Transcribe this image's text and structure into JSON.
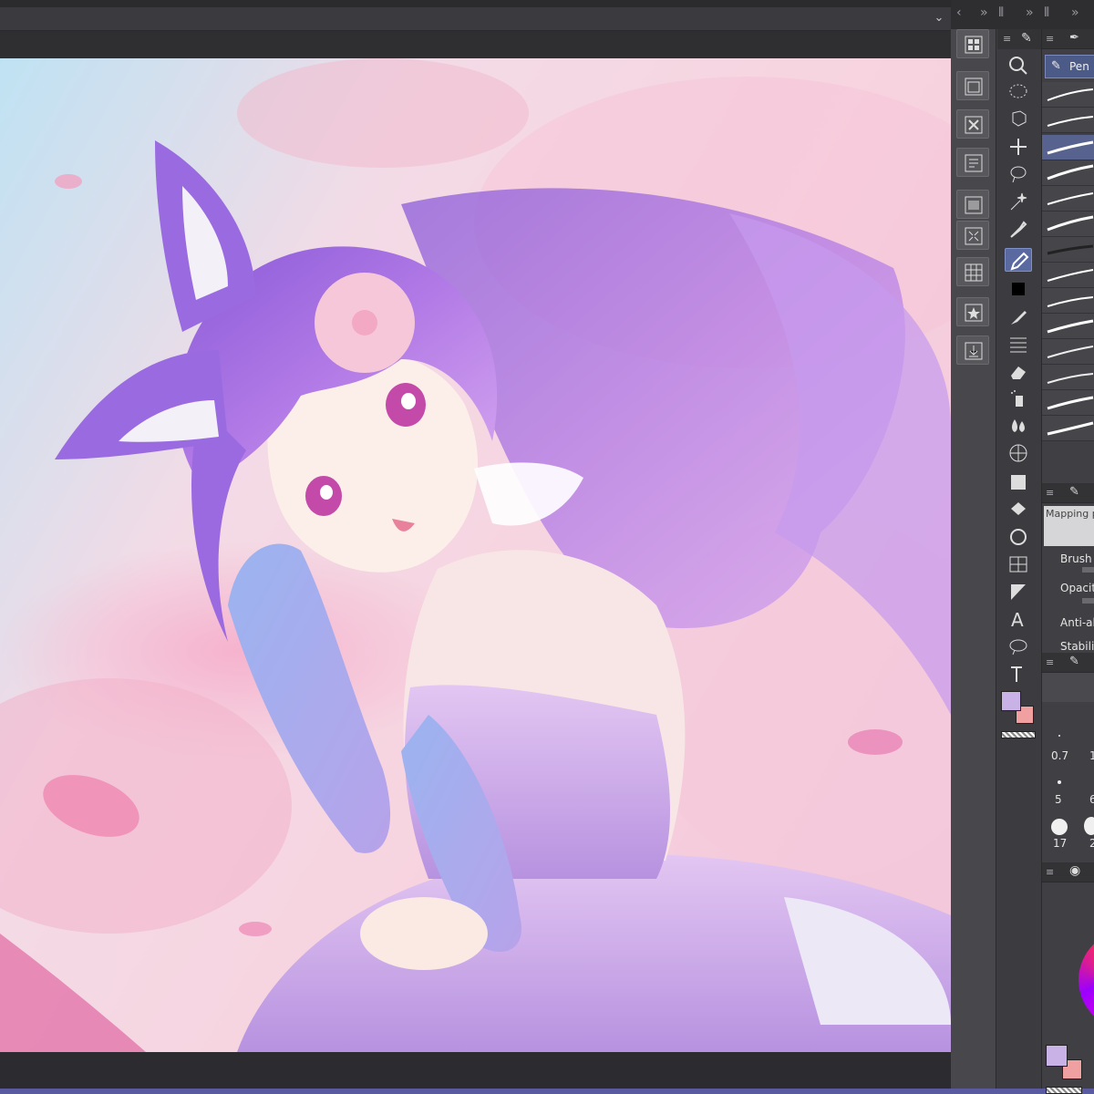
{
  "canvas": {
    "header_dropdown_icon": "chevron-down-icon"
  },
  "dock": {
    "collapse_icons": [
      "chevron-left-icon",
      "double-chevron-right-icon",
      "double-chevron-right-icon"
    ]
  },
  "command_bar": {
    "buttons": [
      "new-icon",
      "open-icon",
      "close-icon",
      "save-icon",
      "layer-icon",
      "resize-icon",
      "grid-icon",
      "favorite-icon",
      "export-icon"
    ]
  },
  "tools": {
    "items": [
      "zoom-icon",
      "lasso-select-icon",
      "object-icon",
      "move-icon",
      "selection-icon",
      "auto-select-icon",
      "eyedropper-icon",
      "pen-icon",
      "color-icon",
      "brush-icon",
      "line-icon",
      "eraser-icon",
      "spray-icon",
      "blend-icon",
      "perspective-icon",
      "fill-icon",
      "gradient-icon",
      "contour-icon",
      "frame-icon",
      "ruler-icon",
      "text-icon",
      "balloon-icon",
      "correct-line-icon"
    ],
    "active": "pen-icon"
  },
  "sub_tool": {
    "tab_label": "Pen"
  },
  "tool_property": {
    "mapping_label": "Mapping p",
    "rows": [
      {
        "label": "Brush"
      },
      {
        "label": "Opacit"
      },
      {
        "label": "Anti-ali"
      },
      {
        "label": "Stabiliz"
      }
    ]
  },
  "brush_size": {
    "values": [
      "0.7",
      "1",
      "5",
      "6",
      "17",
      "2"
    ]
  },
  "colors": {
    "main": "#c9b3e6",
    "sub": "#f0a0a0",
    "accent": "#7d8ac0",
    "panel_bg": "#3f3f43"
  }
}
